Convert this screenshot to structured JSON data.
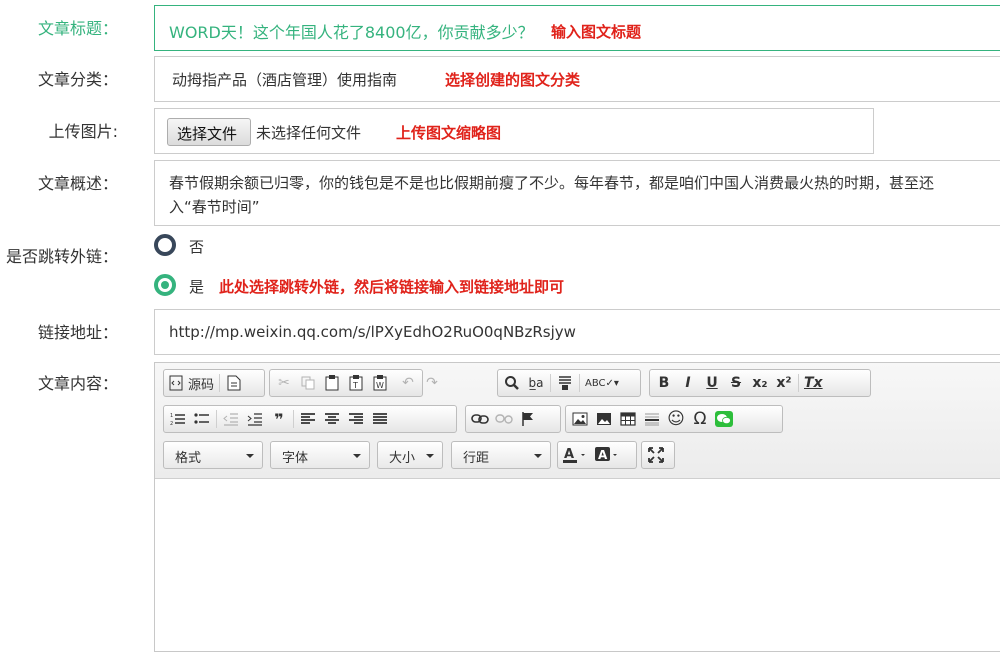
{
  "form": {
    "title": {
      "label": "文章标题：",
      "value": "WORD天！这个年国人花了8400亿，你贡献多少？",
      "hint": "输入图文标题"
    },
    "category": {
      "label": "文章分类：",
      "value": "动拇指产品（酒店管理）使用指南",
      "hint": "选择创建的图文分类"
    },
    "image": {
      "label": "上传图片:",
      "button": "选择文件",
      "status": "未选择任何文件",
      "hint": "上传图文缩略图"
    },
    "summary": {
      "label": "文章概述：",
      "line1": "春节假期余额已归零，你的钱包是不是也比假期前瘦了不少。每年春节，都是咱们中国人消费最火热的时期，甚至还",
      "line2": "入“春节时间”"
    },
    "redirect": {
      "label": "是否跳转外链：",
      "option_no": "否",
      "option_yes": "是",
      "hint": "此处选择跳转外链，然后将链接输入到链接地址即可",
      "selected": "是"
    },
    "link": {
      "label": "链接地址：",
      "value": "http://mp.weixin.qq.com/s/lPXyEdhO2RuO0qNBzRsjyw"
    },
    "content": {
      "label": "文章内容："
    }
  },
  "editor": {
    "source_label": "源码",
    "format_label": "格式",
    "font_label": "字体",
    "size_label": "大小",
    "lineheight_label": "行距",
    "glyphs": {
      "bold": "B",
      "italic": "I",
      "underline": "U",
      "strike": "S",
      "sub": "x₂",
      "sup": "x²",
      "clear": "Tx",
      "quote": "❞",
      "omega": "Ω",
      "smiley": "☺",
      "find": "🔍",
      "undo": "↶",
      "redo": "↷"
    }
  },
  "colors": {
    "accent": "#35b37e",
    "hint": "#e0231b",
    "radio_off": "#38475a"
  }
}
